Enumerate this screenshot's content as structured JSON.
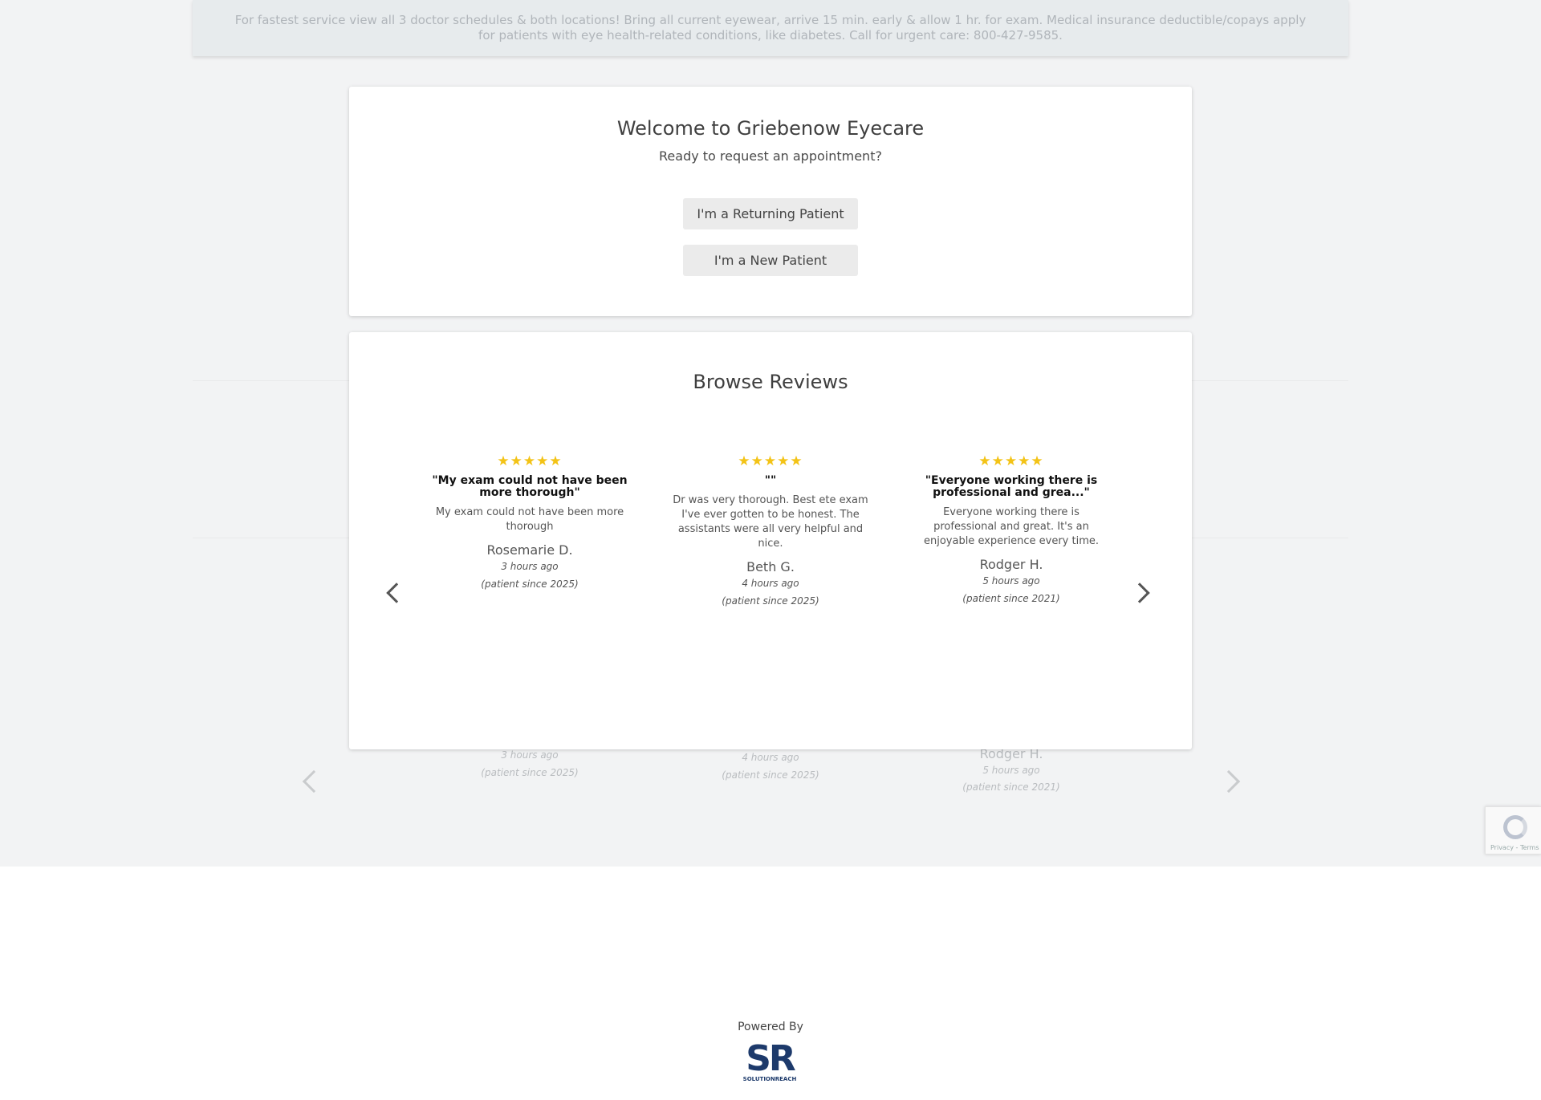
{
  "notice": {
    "text": "For fastest service view all 3 doctor schedules & both locations! Bring all current eyewear, arrive 15 min. early & allow 1 hr. for exam. Medical insurance deductible/copays apply for patients with eye health-related conditions, like diabetes. Call for urgent care: 800-427-9585."
  },
  "welcome": {
    "title": "Welcome to Griebenow Eyecare",
    "subtitle": "Ready to request an appointment?",
    "returning_label": "I'm a Returning Patient",
    "new_label": "I'm a New Patient"
  },
  "reviews": {
    "title": "Browse Reviews",
    "items": [
      {
        "stars": "★★★★★",
        "rating": 5,
        "headline": "\"My exam could not have been more thorough\"",
        "body": "My exam could not have been more thorough",
        "name": "Rosemarie D.",
        "time": "3 hours ago",
        "since": "(patient since 2025)"
      },
      {
        "stars": "★★★★★",
        "rating": 5,
        "headline": "\"\"",
        "body": "Dr was very thorough. Best ete exam I've ever gotten to be honest. The assistants were all very helpful and nice.",
        "name": "Beth G.",
        "time": "4 hours ago",
        "since": "(patient since 2025)"
      },
      {
        "stars": "★★★★★",
        "rating": 5,
        "headline": "\"Everyone working there is professional and grea...\"",
        "body": "Everyone working there is professional and great. It's an enjoyable experience every time.",
        "name": "Rodger H.",
        "time": "5 hours ago",
        "since": "(patient since 2021)"
      }
    ]
  },
  "recaptcha": {
    "terms": "Privacy - Terms"
  },
  "footer": {
    "powered_by": "Powered By",
    "brand": "SOLUTIONREACH"
  },
  "colors": {
    "star": "#f3c316",
    "brand_navy": "#1d3a6b",
    "page_bg": "#f2f3f4"
  }
}
